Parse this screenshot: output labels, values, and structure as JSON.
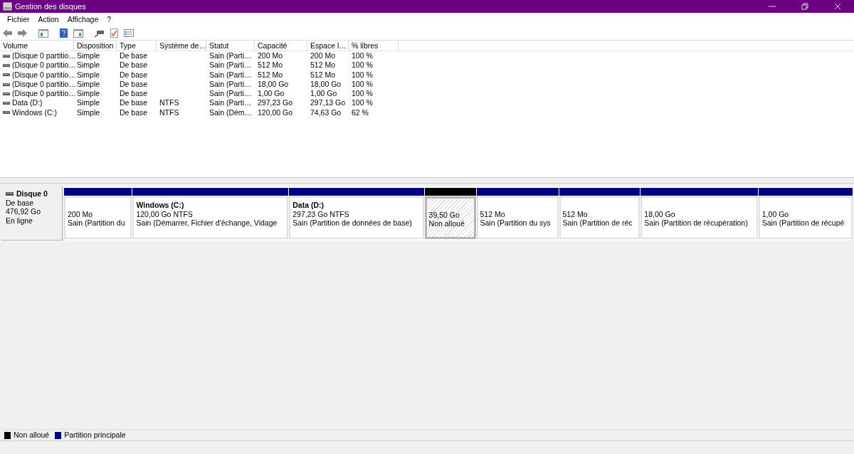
{
  "window": {
    "title": "Gestion des disques"
  },
  "menu": [
    "Fichier",
    "Action",
    "Affichage",
    "?"
  ],
  "table": {
    "columns": [
      "Volume",
      "Disposition",
      "Type",
      "Système de…",
      "Statut",
      "Capacité",
      "Espace l…",
      "% libres"
    ],
    "rows": [
      [
        "(Disque 0 partitio…",
        "Simple",
        "De base",
        "",
        "Sain (Parti…",
        "200 Mo",
        "200 Mo",
        "100 %"
      ],
      [
        "(Disque 0 partitio…",
        "Simple",
        "De base",
        "",
        "Sain (Parti…",
        "512 Mo",
        "512 Mo",
        "100 %"
      ],
      [
        "(Disque 0 partitio…",
        "Simple",
        "De base",
        "",
        "Sain (Parti…",
        "512 Mo",
        "512 Mo",
        "100 %"
      ],
      [
        "(Disque 0 partitio…",
        "Simple",
        "De base",
        "",
        "Sain (Parti…",
        "18,00 Go",
        "18,00 Go",
        "100 %"
      ],
      [
        "(Disque 0 partitio…",
        "Simple",
        "De base",
        "",
        "Sain (Parti…",
        "1,00 Go",
        "1,00 Go",
        "100 %"
      ],
      [
        "Data (D:)",
        "Simple",
        "De base",
        "NTFS",
        "Sain (Parti…",
        "297,23 Go",
        "297,13 Go",
        "100 %"
      ],
      [
        "Windows (C:)",
        "Simple",
        "De base",
        "NTFS",
        "Sain (Dém…",
        "120,00 Go",
        "74,63 Go",
        "62 %"
      ]
    ]
  },
  "disk": {
    "name": "Disque 0",
    "type": "De base",
    "size": "476,92 Go",
    "state": "En ligne"
  },
  "partitions": [
    {
      "kind": "primary",
      "selected": false,
      "size": "200 Mo",
      "status": "Sain (Partition du"
    },
    {
      "kind": "primary",
      "selected": false,
      "name": "Windows  (C:)",
      "size": "120,00 Go NTFS",
      "status": "Sain (Démarrer, Fichier d'échange, Vidage"
    },
    {
      "kind": "primary",
      "selected": false,
      "name": "Data  (D:)",
      "size": "297,23 Go NTFS",
      "status": "Sain (Partition de données de base)"
    },
    {
      "kind": "unallocated",
      "selected": true,
      "size": "39,50 Go",
      "status": "Non alloué"
    },
    {
      "kind": "primary",
      "selected": false,
      "size": "512 Mo",
      "status": "Sain (Partition du sys"
    },
    {
      "kind": "primary",
      "selected": false,
      "size": "512 Mo",
      "status": "Sain (Partition de réc"
    },
    {
      "kind": "primary",
      "selected": false,
      "size": "18,00 Go",
      "status": "Sain (Partition de récupération)"
    },
    {
      "kind": "primary",
      "selected": false,
      "size": "1,00 Go",
      "status": "Sain (Partition de récupé"
    }
  ],
  "legend": [
    {
      "label": "Non alloué",
      "color": "#000000"
    },
    {
      "label": "Partition principale",
      "color": "#000080"
    }
  ]
}
